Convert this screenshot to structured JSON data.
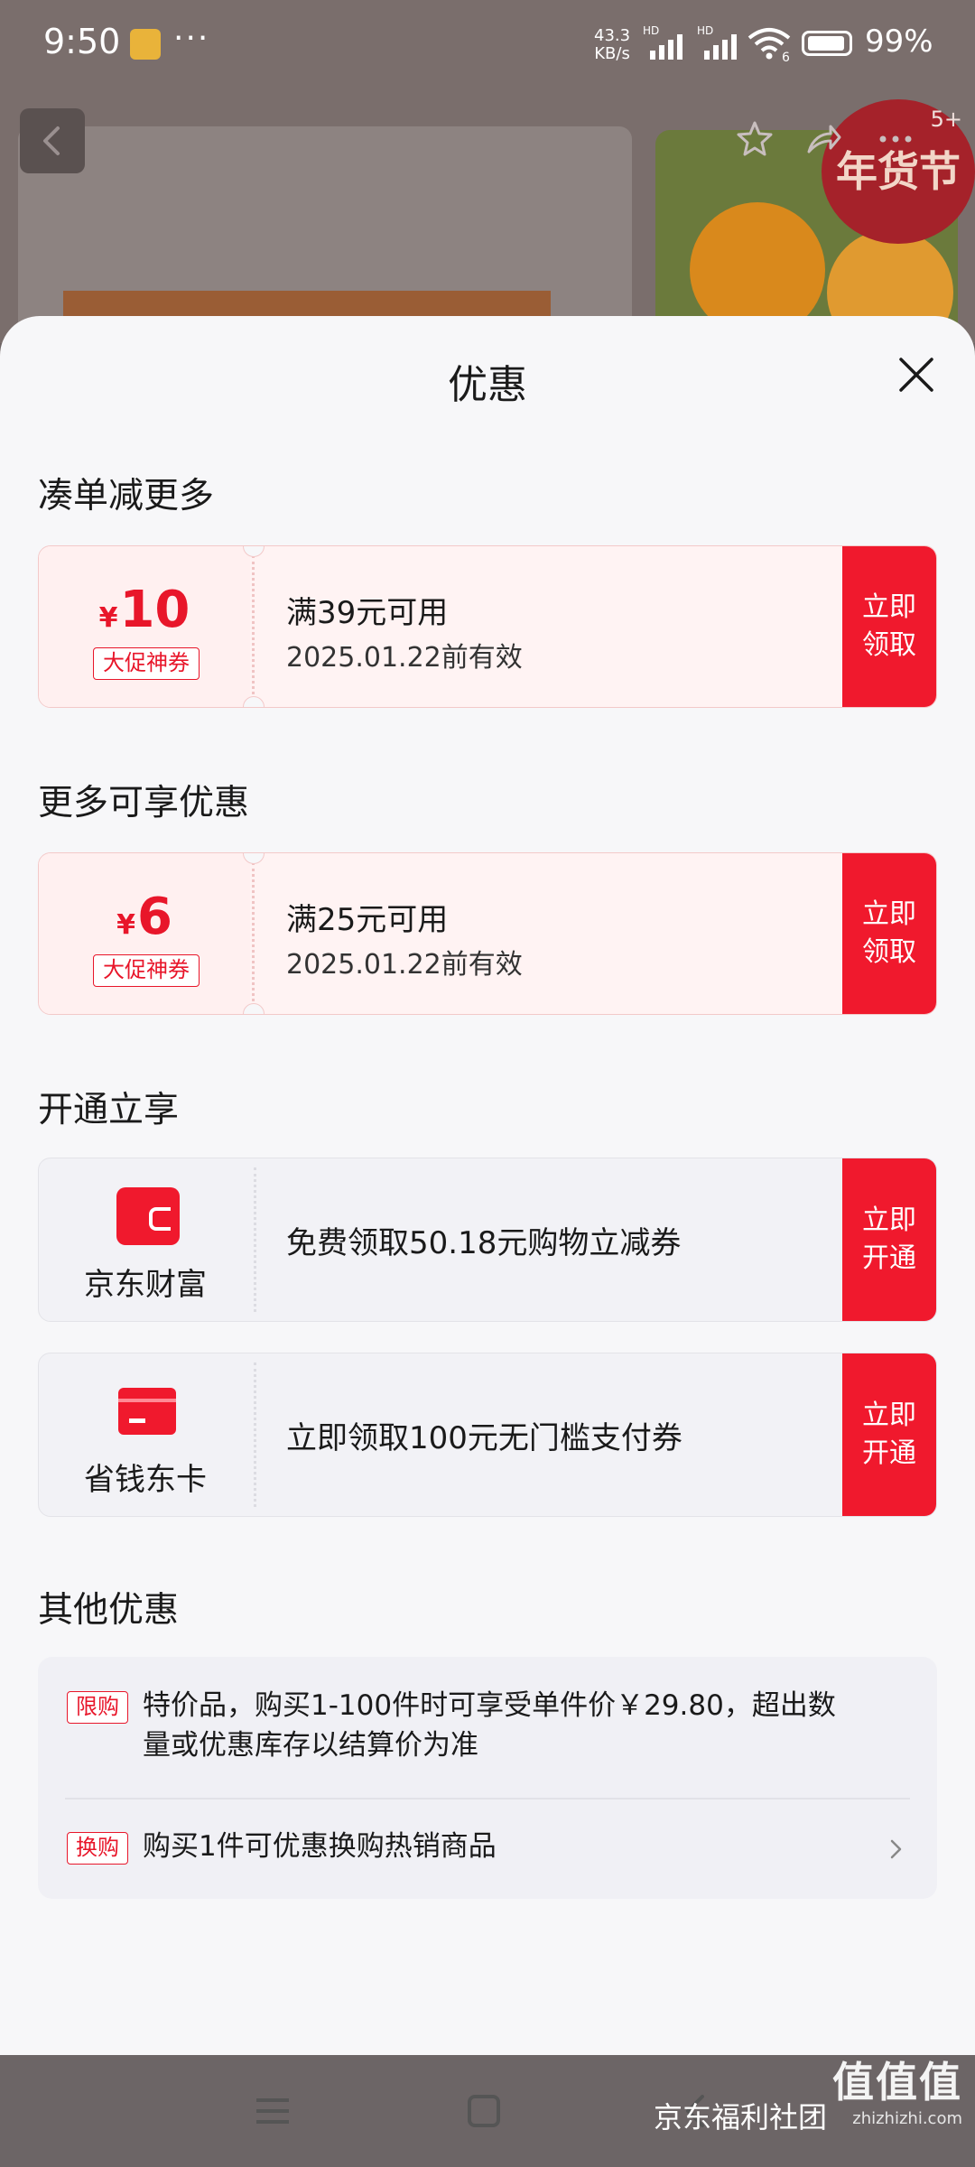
{
  "status_bar": {
    "time": "9:50",
    "dots": "···",
    "speed_top": "43.3",
    "speed_unit": "KB/s",
    "hd1": "HD",
    "hd2": "HD",
    "wifi_badge": "6",
    "battery": "99%"
  },
  "background": {
    "festival_badge": "年货节",
    "notification_count": "5+",
    "icons": [
      "back-icon",
      "star-icon",
      "share-icon",
      "more-icon"
    ]
  },
  "sheet": {
    "title": "优惠",
    "close_icon": "close-icon"
  },
  "sections": {
    "bundle": {
      "title": "凑单减更多",
      "coupon": {
        "currency": "¥",
        "amount": "10",
        "tag": "大促神券",
        "condition": "满39元可用",
        "validity": "2025.01.22前有效",
        "button": "立即领取"
      }
    },
    "more": {
      "title": "更多可享优惠",
      "coupon": {
        "currency": "¥",
        "amount": "6",
        "tag": "大促神券",
        "condition": "满25元可用",
        "validity": "2025.01.22前有效",
        "button": "立即领取"
      }
    },
    "membership": {
      "title": "开通立享",
      "items": [
        {
          "name": "京东财富",
          "icon": "wallet-icon",
          "desc": "免费领取50.18元购物立减券",
          "button": "立即开通"
        },
        {
          "name": "省钱东卡",
          "icon": "card-icon",
          "desc": "立即领取100元无门槛支付券",
          "button": "立即开通"
        }
      ]
    },
    "other": {
      "title": "其他优惠",
      "items": [
        {
          "tag": "限购",
          "line1": "特价品，购买1-100件时可享受单件价￥29.80，超出数",
          "line2": "量或优惠库存以结算价为准"
        },
        {
          "tag": "换购",
          "text": "购买1件可优惠换购热销商品"
        }
      ]
    }
  },
  "watermark": {
    "big": "值值值",
    "text": "京东福利社团",
    "url": "zhizhizhi.com"
  },
  "colors": {
    "accent": "#f0192d",
    "coupon_bg": "#fff3f3",
    "sheet_bg": "#f7f7f9"
  }
}
